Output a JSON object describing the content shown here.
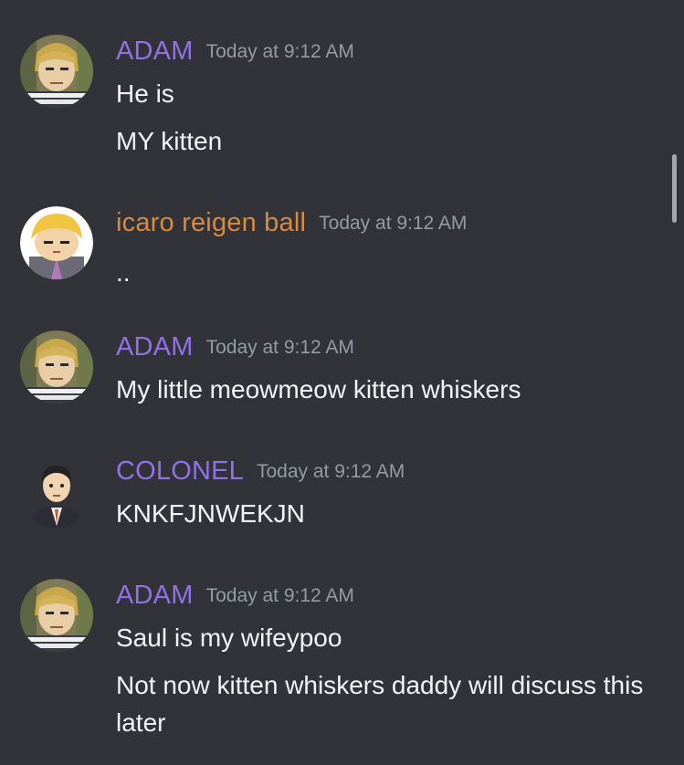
{
  "colors": {
    "background": "#313338",
    "text": "#f2f3f5",
    "timestamp": "#949ba4",
    "purple_role": "#9370e6",
    "orange_role": "#d98a3f"
  },
  "messages": [
    {
      "username": "ADAM",
      "name_color": "#9370e6",
      "timestamp": "Today at 9:12 AM",
      "avatar_icon": "reigen-meme-avatar-icon",
      "lines": [
        "He is",
        "MY kitten"
      ]
    },
    {
      "username": "icaro reigen ball",
      "name_color": "#d98a3f",
      "timestamp": "Today at 9:12 AM",
      "avatar_icon": "reigen-chibi-avatar-icon",
      "lines": [
        ".."
      ]
    },
    {
      "username": "ADAM",
      "name_color": "#9370e6",
      "timestamp": "Today at 9:12 AM",
      "avatar_icon": "reigen-meme-avatar-icon",
      "lines": [
        "My little meowmeow kitten whiskers"
      ]
    },
    {
      "username": "COLONEL",
      "name_color": "#9370e6",
      "timestamp": "Today at 9:12 AM",
      "avatar_icon": "serizawa-avatar-icon",
      "lines": [
        "KNKFJNWEKJN"
      ]
    },
    {
      "username": "ADAM",
      "name_color": "#9370e6",
      "timestamp": "Today at 9:12 AM",
      "avatar_icon": "reigen-meme-avatar-icon",
      "lines": [
        "Saul is my wifeypoo",
        "Not now kitten whiskers daddy will discuss this later"
      ]
    }
  ]
}
